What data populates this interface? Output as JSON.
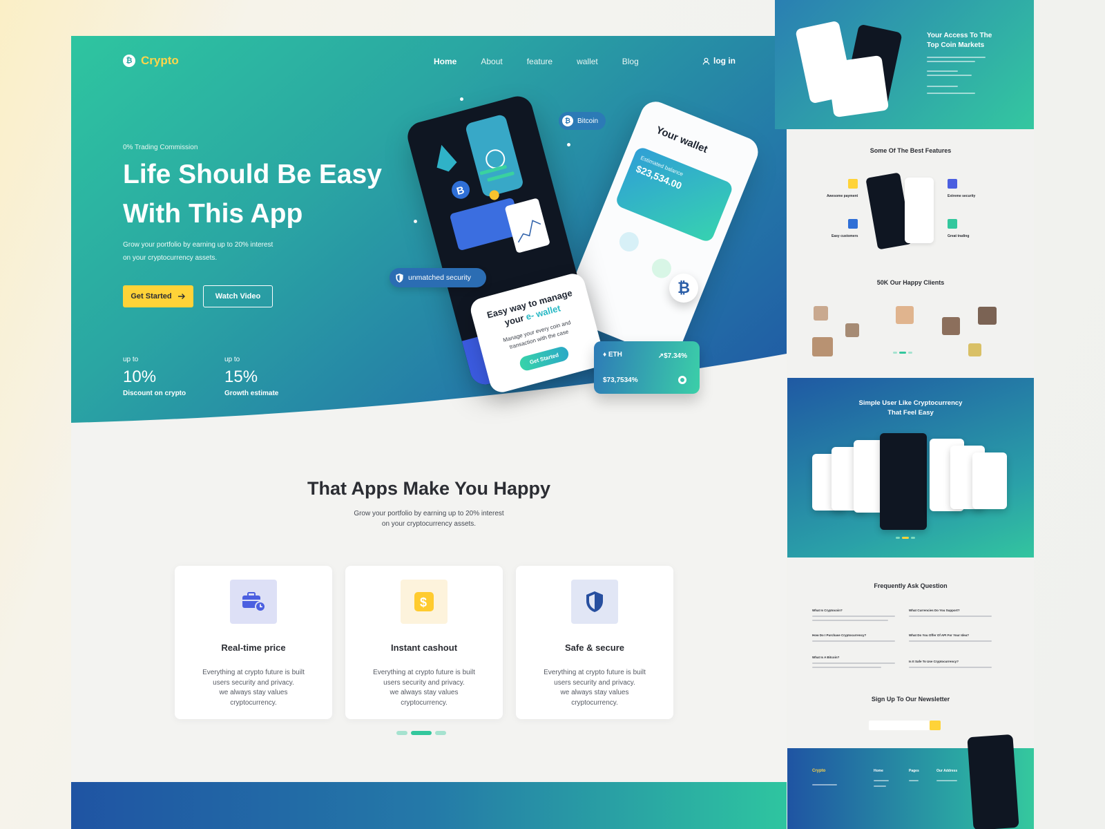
{
  "nav": {
    "logo": "Crypto",
    "logo_glyph": "₿",
    "links": [
      "Home",
      "About",
      "feature",
      "wallet",
      "Blog"
    ],
    "login": "log in"
  },
  "hero": {
    "tagline": "0% Trading Commission",
    "title_line1": "Life Should Be  Easy",
    "title_line2": "With This App",
    "desc_line1": "Grow your  portfolio by earning up to 20% interest",
    "desc_line2": "on your cryptocurrency assets.",
    "btn_start": "Get Started",
    "btn_watch": "Watch Video",
    "stats": [
      {
        "upto": "up to",
        "value": "10%",
        "caption": "Discount on crypto"
      },
      {
        "upto": "up to",
        "value": "15%",
        "caption": "Growth estimate"
      }
    ],
    "pill_security": "unmatched security",
    "pill_bitcoin": "Bitcoin",
    "wallet_title": "Your wallet",
    "wallet_card_label": "Estimated balance",
    "wallet_card_amount": "$23,534.00",
    "manage_title_1": "Easy way to manage",
    "manage_title_2a": "your",
    "manage_title_2b": "e- wallet",
    "manage_desc": "Manage your every coin  and transaction with the case",
    "manage_btn": "Get Started",
    "eth_label": "ETH",
    "eth_change": "↗$7.34%",
    "eth_value": "$73,7534%",
    "btc_badge": "₿"
  },
  "section": {
    "title": "That Apps Make You Happy",
    "desc_line1": "Grow your  portfolio by earning up to 20% interest",
    "desc_line2": "on your cryptocurrency assets."
  },
  "cards": [
    {
      "title": "Real-time price",
      "icon": "briefcase-clock-icon",
      "icon_bg": "#dde0f6",
      "icon_color": "#4b5fe0",
      "l1": "Everything  at crypto future is built",
      "l2": "users security and privacy.",
      "l3": "we always stay  values",
      "l4": "cryptocurrency."
    },
    {
      "title": "Instant cashout",
      "icon": "dollar-icon",
      "icon_bg": "#fdf3dc",
      "icon_color": "#ffcb2f",
      "l1": "Everything  at crypto future is built",
      "l2": "users security and privacy.",
      "l3": "we always stay  values",
      "l4": "cryptocurrency."
    },
    {
      "title": "Safe & secure",
      "icon": "shield-icon",
      "icon_bg": "#e1e6f5",
      "icon_color": "#274f9f",
      "l1": "Everything  at crypto future is built",
      "l2": "users security and privacy.",
      "l3": "we always stay  values",
      "l4": "cryptocurrency."
    }
  ],
  "preview": {
    "access_title": "Your Access To The Top Coin Markets",
    "features_title": "Some Of The Best Features",
    "features": [
      "Awesome payment",
      "Easy customers",
      "Extreme security",
      "Great trading"
    ],
    "clients_title": "50K Our Happy Clients",
    "simple_title_1": "Simple User Like Cryptocurrency",
    "simple_title_2": "That Feel Easy",
    "faq_title": "Frequently Ask Question",
    "faq": [
      "What Is Cryptocoin?",
      "How Do I Purchase Cryptocurrency?",
      "What Is A Bitcoin?",
      "What Currencies Do You Support?",
      "What Do You Offer Of API For Your Idea?",
      "Is It Safe To Use Cryptocurrency?"
    ],
    "newsletter_title": "Sign Up To Our Newsletter",
    "footer_logo": "Crypto",
    "footer_heads": [
      "Home",
      "Pages",
      "Our Address"
    ]
  },
  "colors": {
    "accent_yellow": "#ffd338",
    "brand_green": "#2ec5a0",
    "brand_blue": "#1f54a3"
  }
}
